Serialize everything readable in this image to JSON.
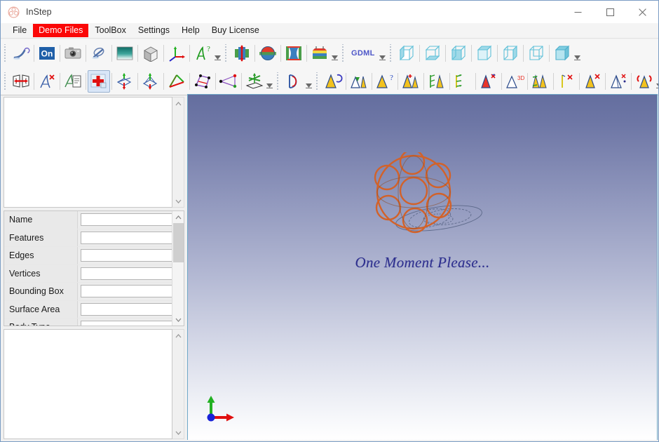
{
  "window": {
    "title": "InStep",
    "logo_icon": "sphere-logo-icon",
    "controls": {
      "minimize_label": "Minimize",
      "minimize_icon": "minimize-icon",
      "maximize_label": "Maximize",
      "maximize_icon": "maximize-icon",
      "close_label": "Close",
      "close_icon": "close-icon"
    }
  },
  "menubar": {
    "items": [
      {
        "label": "File",
        "highlighted": false
      },
      {
        "label": "Demo Files",
        "highlighted": true
      },
      {
        "label": "ToolBox",
        "highlighted": false
      },
      {
        "label": "Settings",
        "highlighted": false
      },
      {
        "label": "Help",
        "highlighted": false
      },
      {
        "label": "Buy License",
        "highlighted": false
      }
    ],
    "highlight_color": "#fb0707",
    "highlight_text_color": "#ffffff"
  },
  "toolbars": {
    "row1": {
      "groups": [
        {
          "grip": true,
          "buttons": [
            {
              "icon": "curve-sweep-icon",
              "label": "Sweep Curve"
            },
            {
              "icon": "on-toggle-icon",
              "label": "On"
            },
            {
              "icon": "camera-icon",
              "label": "Snapshot"
            },
            {
              "icon": "orbit-rotate-icon",
              "label": "Orbit"
            },
            {
              "icon": "gradient-swatch-icon",
              "label": "Background Gradient"
            },
            {
              "icon": "solid-cube-icon",
              "label": "Solid View"
            },
            {
              "icon": "axis-triad-icon",
              "label": "Show Axes"
            },
            {
              "icon": "alpha-query-icon",
              "label": "Help Query"
            }
          ],
          "chevron": true
        },
        {
          "grip": true,
          "buttons": [
            {
              "icon": "rgb-cylinder-icon",
              "label": "RGB Cylinder"
            },
            {
              "icon": "rgb-sphere-icon",
              "label": "RGB Sphere"
            },
            {
              "icon": "rgb-hyperboloid-icon",
              "label": "RGB Hyperboloid"
            },
            {
              "icon": "rgb-stack-icon",
              "label": "RGB Stack"
            }
          ],
          "chevron": true
        },
        {
          "grip": true,
          "buttons": [
            {
              "icon": "gdml-text-icon",
              "label": "GDML"
            }
          ],
          "chevron": true
        },
        {
          "grip": true,
          "buttons": [
            {
              "icon": "box-face-front-icon",
              "label": "Front Face"
            },
            {
              "icon": "box-face-bottom-icon",
              "label": "Bottom Face"
            },
            {
              "icon": "box-face-left-icon",
              "label": "Left Face"
            },
            {
              "icon": "box-face-top-icon",
              "label": "Top Face"
            },
            {
              "icon": "box-face-right-icon",
              "label": "Right Face"
            },
            {
              "icon": "box-face-back-icon",
              "label": "Back Face"
            },
            {
              "icon": "box-all-faces-icon",
              "label": "All Faces"
            }
          ],
          "chevron": true
        }
      ]
    },
    "row2": {
      "groups": [
        {
          "grip": true,
          "buttons": [
            {
              "icon": "merge-faces-icon",
              "label": "Merge Faces"
            },
            {
              "icon": "delete-face-icon",
              "label": "Delete Face"
            },
            {
              "icon": "face-report-icon",
              "label": "Face Report"
            },
            {
              "icon": "add-feature-icon",
              "label": "Add Feature",
              "active": true
            },
            {
              "icon": "project-down-icon",
              "label": "Project Down"
            },
            {
              "icon": "project-up-icon",
              "label": "Project Up"
            },
            {
              "icon": "triangle-edges-icon",
              "label": "Edge Colors"
            },
            {
              "icon": "quad-vertices-icon",
              "label": "Vertex Handles"
            },
            {
              "icon": "angle-measure-icon",
              "label": "Measure Angle"
            },
            {
              "icon": "plane-section-icon",
              "label": "Section Plane"
            }
          ],
          "chevron": true
        },
        {
          "grip": true,
          "buttons": [
            {
              "icon": "d-profile-icon",
              "label": "Profile"
            }
          ],
          "chevron": true
        },
        {
          "grip": true,
          "buttons": [
            {
              "icon": "cone-rotate-icon",
              "label": "Rotate Cone"
            },
            {
              "icon": "cone-shade-icon",
              "label": "Shade Cone"
            },
            {
              "icon": "cone-query-icon",
              "label": "Query Cone"
            },
            {
              "icon": "cone-add-icon",
              "label": "Add Cone"
            },
            {
              "icon": "cone-pair-icon",
              "label": "Cone Pair"
            },
            {
              "icon": "cone-arrows-icon",
              "label": "Cone Arrows"
            },
            {
              "icon": "cone-red-icon",
              "label": "Red Cone"
            },
            {
              "icon": "cone-3d-icon",
              "label": "3D Cone"
            },
            {
              "icon": "cone-extrude-icon",
              "label": "Extrude Cone"
            },
            {
              "icon": "axis-pin-icon",
              "label": "Axis Pin"
            },
            {
              "icon": "cone-gold-icon",
              "label": "Gold Cone"
            },
            {
              "icon": "cone-point-icon",
              "label": "Point Cone"
            },
            {
              "icon": "cone-spin-icon",
              "label": "Spin Cone"
            }
          ],
          "chevron": true
        }
      ]
    }
  },
  "left_dock": {
    "top_list": {
      "name": "model-tree-list",
      "items": []
    },
    "properties": {
      "rows": [
        {
          "name": "Name",
          "value": ""
        },
        {
          "name": "Features",
          "value": ""
        },
        {
          "name": "Edges",
          "value": ""
        },
        {
          "name": "Vertices",
          "value": ""
        },
        {
          "name": "Bounding Box",
          "value": ""
        },
        {
          "name": "Surface Area",
          "value": ""
        },
        {
          "name": "Body Type",
          "value": ""
        }
      ],
      "scroll_up_icon": "chevron-up-icon",
      "scroll_down_icon": "chevron-down-icon"
    },
    "bottom_list": {
      "name": "message-log-list",
      "items": []
    }
  },
  "viewport": {
    "loading_text": "One Moment Please...",
    "loading_text_color": "#2d2f8e",
    "model_icon": "wireframe-sphere-icon",
    "model_color": "#d2622a",
    "shadow_color": "#3c4a72",
    "background_top": "#646e9f",
    "background_bottom": "#ffffff",
    "axis_gizmo": {
      "icon": "axis-gizmo-icon",
      "origin_color": "#1822d8",
      "x_axis_color": "#e01010",
      "y_axis_color": "#22b022"
    }
  }
}
